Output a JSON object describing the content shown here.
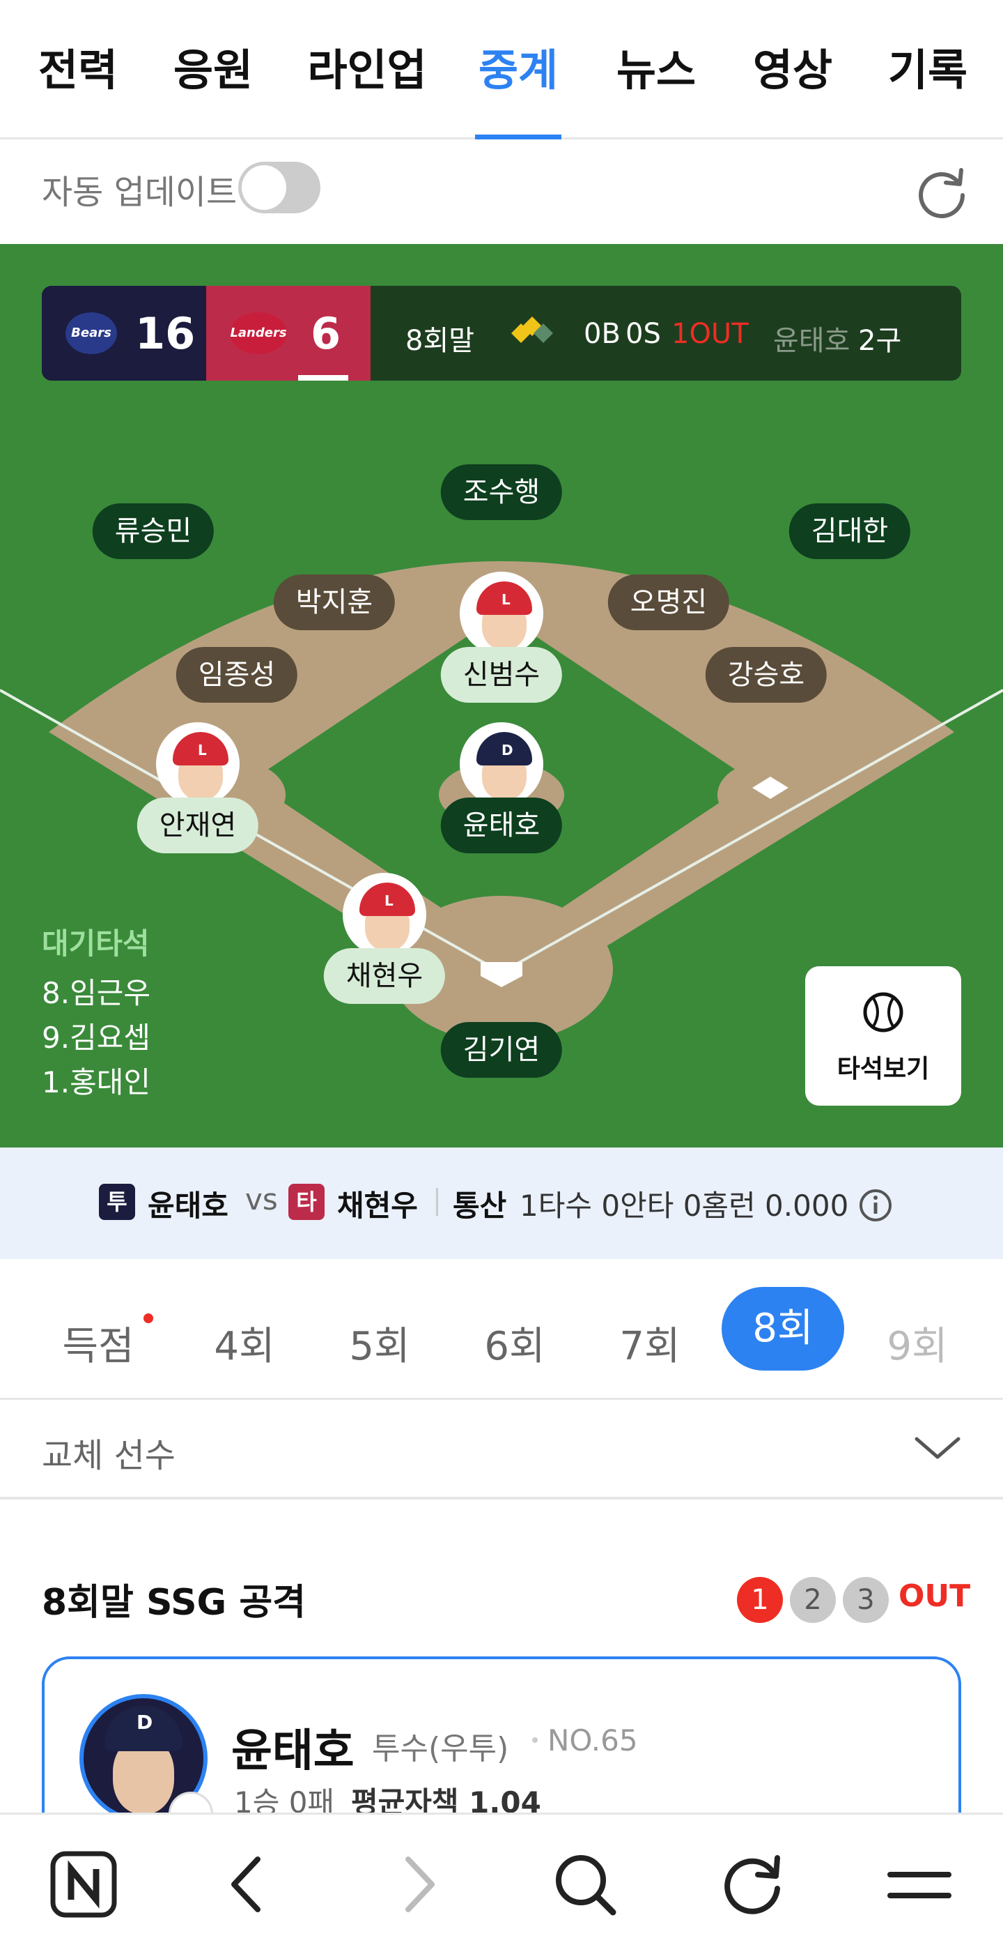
{
  "tabs": [
    {
      "label": "전력",
      "active": false
    },
    {
      "label": "응원",
      "active": false
    },
    {
      "label": "라인업",
      "active": false
    },
    {
      "label": "중계",
      "active": true
    },
    {
      "label": "뉴스",
      "active": false
    },
    {
      "label": "영상",
      "active": false
    },
    {
      "label": "기록",
      "active": false
    }
  ],
  "auto_update": {
    "label": "자동 업데이트",
    "enabled": false
  },
  "scoreboard": {
    "away": {
      "logo_text": "Bears",
      "score": "16",
      "color": "#1b1c3e"
    },
    "home": {
      "logo_text": "Landers",
      "score": "6",
      "color": "#bd2b4a"
    },
    "inning": "8회말",
    "count_b": "0B",
    "count_s": "0S",
    "outs": "1OUT",
    "pitcher": "윤태호",
    "pitch_count": "2구"
  },
  "field": {
    "outfield_left": "류승민",
    "outfield_center": "조수행",
    "outfield_right": "김대한",
    "second_base_area": "박지훈",
    "shortstop_area": "오명진",
    "third_base_area": "임종성",
    "first_base_area": "강승호",
    "runner_second": "신범수",
    "runner_third": "안재연",
    "pitcher": "윤태호",
    "batter": "채현우",
    "catcher": "김기연"
  },
  "on_deck": {
    "title": "대기타석",
    "batters": [
      "8.임근우",
      "9.김요셉",
      "1.홍대인"
    ]
  },
  "bat_view_label": "타석보기",
  "matchup": {
    "pitcher_badge": "투",
    "pitcher": "윤태호",
    "vs": "vs",
    "batter_badge": "타",
    "batter": "채현우",
    "career_label": "통산",
    "stats": "1타수 0안타 0홈런 0.000"
  },
  "innings": [
    {
      "label": "득점",
      "state": "normal"
    },
    {
      "label": "4회",
      "state": "normal"
    },
    {
      "label": "5회",
      "state": "normal"
    },
    {
      "label": "6회",
      "state": "normal"
    },
    {
      "label": "7회",
      "state": "normal"
    },
    {
      "label": "8회",
      "state": "active"
    },
    {
      "label": "9회",
      "state": "disabled"
    }
  ],
  "substitutes_label": "교체 선수",
  "half_inning": {
    "title": "8회말 SSG 공격",
    "out_markers": [
      "1",
      "2",
      "3"
    ],
    "outs_filled": 1,
    "out_label": "OUT"
  },
  "pitcher_card": {
    "name": "윤태호",
    "position": "투수(우투)",
    "number": "NO.65",
    "record": "1승 0패",
    "era": "평균자책 1.04"
  },
  "colors": {
    "accent": "#2d82f2",
    "field_grass": "#3a8a3a",
    "infield_dirt": "#b8a07f",
    "out_red": "#ee2d24"
  }
}
